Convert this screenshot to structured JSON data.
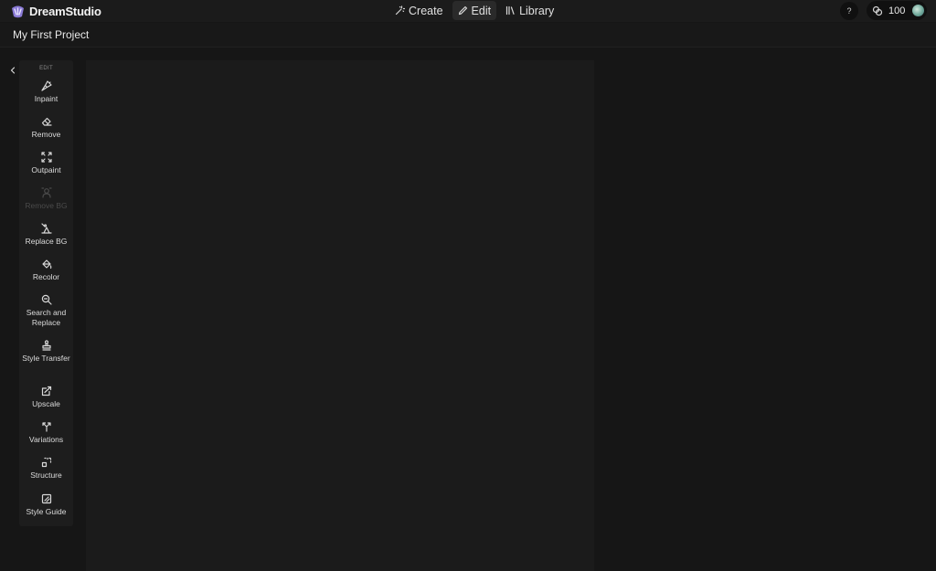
{
  "header": {
    "brand": "DreamStudio",
    "nav": [
      {
        "label": "Create",
        "icon": "magic-wand-icon",
        "active": false
      },
      {
        "label": "Edit",
        "icon": "pencil-icon",
        "active": true
      },
      {
        "label": "Library",
        "icon": "library-icon",
        "active": false
      }
    ],
    "help": "?",
    "credits": "100"
  },
  "project": {
    "title": "My First Project"
  },
  "toolbar": {
    "section": "EDIT",
    "tools": [
      {
        "label": "Inpaint",
        "icon": "brush-icon",
        "enabled": true
      },
      {
        "label": "Remove",
        "icon": "eraser-icon",
        "enabled": true
      },
      {
        "label": "Outpaint",
        "icon": "expand-icon",
        "enabled": true
      },
      {
        "label": "Remove BG",
        "icon": "person-icon",
        "enabled": false
      },
      {
        "label": "Replace BG",
        "icon": "replace-bg-icon",
        "enabled": true
      },
      {
        "label": "Recolor",
        "icon": "paint-bucket-icon",
        "enabled": true
      },
      {
        "label": "Search and Replace",
        "icon": "search-replace-icon",
        "enabled": true
      },
      {
        "label": "Style Transfer",
        "icon": "stamp-icon",
        "enabled": true
      },
      {
        "label": "Upscale",
        "icon": "upscale-icon",
        "enabled": true
      },
      {
        "label": "Variations",
        "icon": "fork-icon",
        "enabled": true
      },
      {
        "label": "Structure",
        "icon": "structure-icon",
        "enabled": true
      },
      {
        "label": "Style Guide",
        "icon": "style-guide-icon",
        "enabled": true
      }
    ]
  },
  "colors": {
    "background": "#161616",
    "panel": "#1d1d1d",
    "canvas": "#1b1b1b",
    "text": "#e6e6e6",
    "disabled_text": "#4a4a4a"
  }
}
